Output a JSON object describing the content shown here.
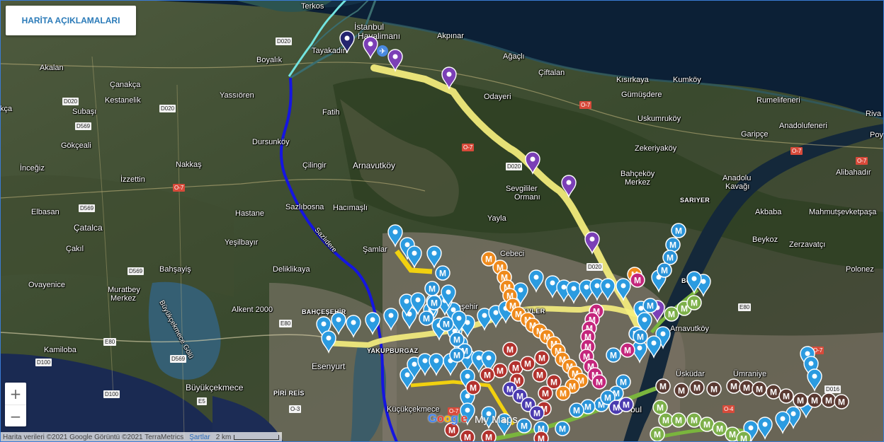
{
  "legend_button": {
    "label": "HARİTA AÇIKLAMALARI"
  },
  "zoom": {
    "in_symbol": "+",
    "out_symbol": "−"
  },
  "footer": {
    "attribution": "Harita verileri ©2021 Google Görüntü ©2021 TerraMetrics",
    "terms": "Şartlar",
    "scale": "2 km"
  },
  "branding": {
    "google": "Google",
    "my_maps": "My Maps"
  },
  "places": {
    "terkos": "Terkos",
    "istanbul_havalimani_1": "İstanbul",
    "istanbul_havalimani_2": "Havalimanı",
    "akpinar": "Akpınar",
    "boyalik": "Boyalık",
    "tayakadin": "Tayakadın",
    "agacli": "Ağaçlı",
    "ciftalan": "Çiftalan",
    "kisirkaya": "Kısırkaya",
    "kumkoy": "Kumköy",
    "gumusdere": "Gümüşdere",
    "akalan": "Akalan",
    "canakca": "Çanakça",
    "kestanelik": "Kestanelik",
    "yassioren": "Yassıören",
    "fatih": "Fatih",
    "odayeri": "Odayeri",
    "rumelifeneri": "Rumelifeneri",
    "rumelikavagi_cut": "Riva",
    "cakca": "kça",
    "subasi": "Subaşı",
    "uskumrukoy": "Uskumruköy",
    "garipce": "Garipçe",
    "anadolufeneri": "Anadolufeneri",
    "gokceali": "Gökçeali",
    "dursunkoy": "Dursunköy",
    "zekeriyakoy": "Zekeriyaköy",
    "poyraz_cut": "Poy",
    "inceğiz": "İnceğiz",
    "nakkas": "Nakkaş",
    "cilingir": "Çilingir",
    "arnavutkoy": "Arnavutköy",
    "bahcekoy_1": "Bahçeköy",
    "bahcekoy_2": "Merkez",
    "anadolu_kavagi_1": "Anadolu",
    "anadolu_kavagi_2": "Kavağı",
    "alibahadir": "Alibahadır",
    "izzettin": "İzzettin",
    "sevgililer_1": "Sevgililer",
    "sevgililer_2": "Ormanı",
    "sariyer": "SARIYER",
    "elbasan": "Elbasan",
    "catalca": "Çatalca",
    "hastane": "Hastane",
    "sazlibosna": "Sazlıbosna",
    "hacimasli": "Hacımaşlı",
    "akbaba": "Akbaba",
    "mahmutsevketpasa": "Mahmutşevketpaşa",
    "yayla": "Yayla",
    "cakil": "Çakıl",
    "yesilbayir": "Yeşilbayır",
    "samlar": "Şamlar",
    "beykoz": "Beykoz",
    "zerzavatci": "Zerzavatçı",
    "cebeci": "Cebeci",
    "bahsayis": "Bahşayiş",
    "deliklikaya": "Deliklikaya",
    "polonez": "Polonez",
    "ovayenice": "Ovayenice",
    "muratbey_1": "Muratbey",
    "muratbey_2": "Merkez",
    "bogazkoy_cut": "Bo",
    "alkent": "Alkent 2000",
    "bahcesehir": "BAHÇEŞEHİR",
    "kucukcekmece_lake": "Büyükçekmece Gölü",
    "sazlidere": "Sazlıdere",
    "esenler_cut": "eşehir",
    "levent_cut": "EVLER",
    "yakuplu_cut": "YAKUPBURGAZ",
    "arnavutkoy_bos": "Arnavutköy",
    "kamiloba": "Kamiloba",
    "esenyurt": "Esenyurt",
    "uskudar_cut": "Üsküdar",
    "umraniye": "Ümraniye",
    "buyukcekmece": "Büyükçekmece",
    "pirireis": "PİRİ REİS",
    "kucukcekmece": "Küçükçekmece",
    "istanbul_cut": "bul"
  },
  "roads": [
    "D020",
    "D020",
    "D020",
    "D020",
    "D569",
    "D569",
    "D569",
    "D569",
    "E80",
    "E80",
    "E80",
    "E5",
    "D100",
    "D100",
    "D016",
    "O-7",
    "O-7",
    "O-7",
    "O-7",
    "O-7",
    "O-7",
    "O-7",
    "O-4",
    "O-3",
    "D020",
    "O-7"
  ],
  "metro_glyph": "M",
  "colors": {
    "yellow_line": "#f6ef7e",
    "blue_line": "#1515e0",
    "cyan_line": "#73e4e0",
    "teal_line": "#3a6d6f",
    "pin_blue": "#2b9be0",
    "pin_purple": "#7b3fb6",
    "pin_navy": "#24246e",
    "metro_blue": "#2a93d8",
    "metro_orange": "#ef8a1c",
    "metro_magenta": "#c4267c",
    "metro_red": "#b3322e",
    "metro_green": "#7db04a",
    "metro_brown": "#5a3a32",
    "metro_indigo": "#4b3bb0",
    "yellow_tram": "#f1d10f",
    "green_line": "#7ab53d",
    "sea": "#0c2036",
    "lake": "#355f73"
  }
}
